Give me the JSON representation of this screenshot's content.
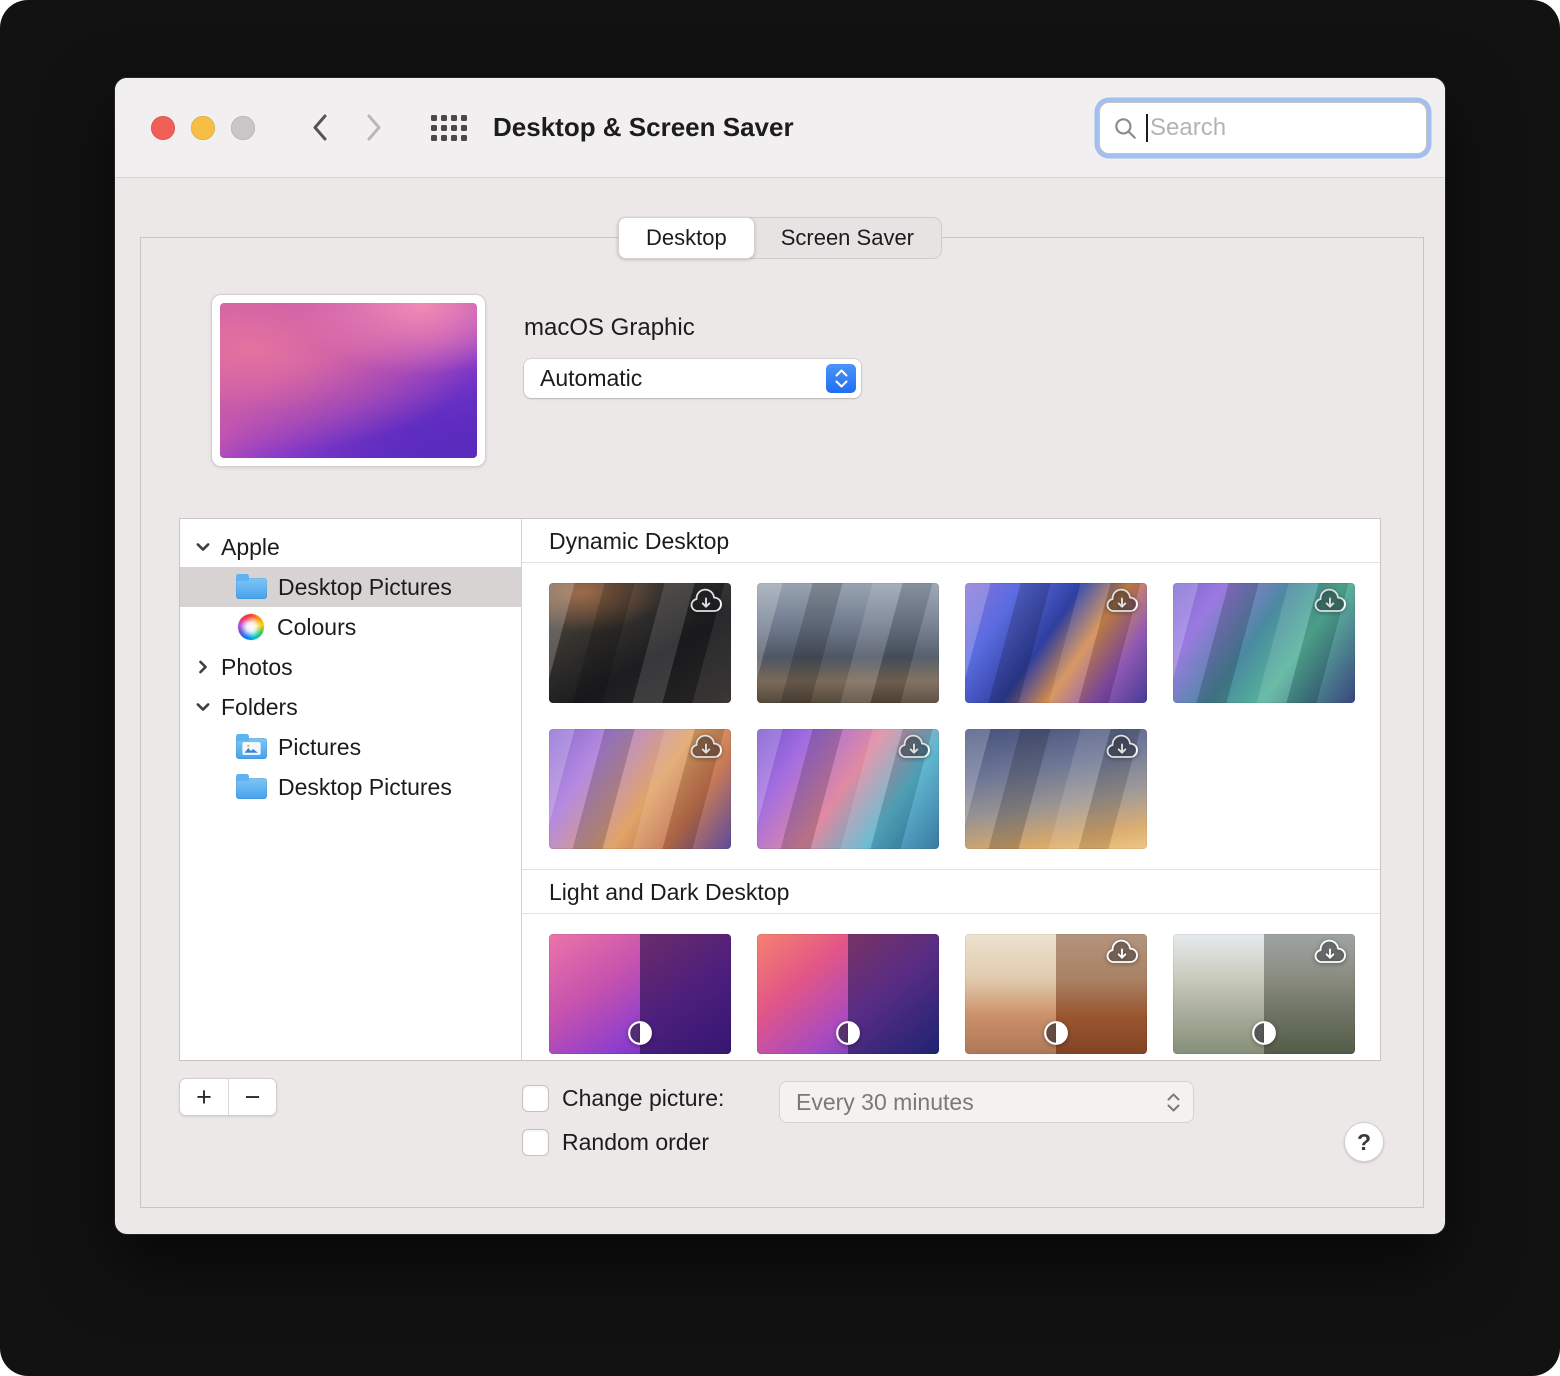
{
  "window": {
    "title": "Desktop & Screen Saver",
    "search_placeholder": "Search"
  },
  "tabs": {
    "desktop": "Desktop",
    "screen_saver": "Screen Saver"
  },
  "current": {
    "name": "macOS Graphic",
    "mode": "Automatic",
    "preview_bg": "radial-gradient(90% 80% at 78% 2%, #f08ab4 0%, rgba(240,138,180,0) 55%), radial-gradient(120% 90% at 12% 30%, #e4739f 0%, rgba(196,90,170,0.6) 45%, rgba(160,70,190,0) 75%), radial-gradient(140% 120% at 85% 95%, #5b2bbf 0%, rgba(91,43,191,0) 60%), linear-gradient(150deg, #e8709f 0%, #c957ae 38%, #9a41c9 62%, #6d32c9 82%, #5b2aa8 100%)"
  },
  "sidebar": {
    "groups": [
      {
        "label": "Apple",
        "expanded": true,
        "items": [
          {
            "label": "Desktop Pictures",
            "icon": "folder-icon",
            "selected": true
          },
          {
            "label": "Colours",
            "icon": "color-wheel-icon",
            "selected": false
          }
        ]
      },
      {
        "label": "Photos",
        "expanded": false,
        "items": []
      },
      {
        "label": "Folders",
        "expanded": true,
        "items": [
          {
            "label": "Pictures",
            "icon": "pictures-folder-icon",
            "selected": false
          },
          {
            "label": "Desktop Pictures",
            "icon": "folder-icon",
            "selected": false
          }
        ]
      }
    ]
  },
  "sections": [
    {
      "title": "Dynamic Desktop",
      "thumbnails": [
        {
          "desc": "dark-rocky-coast",
          "striped": true,
          "cloud": true,
          "contrast": false,
          "bg": "radial-gradient(80% 60% at 18% 8%, rgba(225,140,80,0.55) 0%, rgba(225,140,80,0) 55%), linear-gradient(150deg,#57504b 0%,#37332f 30%,#1c1d20 60%,#2e2a28 100%)"
        },
        {
          "desc": "island-dusk",
          "striped": true,
          "cloud": false,
          "contrast": false,
          "bg": "linear-gradient(180deg,#9aa4b2 0%,#707c8e 35%,#4e5663 62%,#7b6a58 82%,#55493c 100%)"
        },
        {
          "desc": "graphic-coast-road",
          "striped": true,
          "cloud": true,
          "contrast": false,
          "bg": "linear-gradient(125deg,#8a72d8 0%,#5a6ce0 22%,#2f3f9f 45%,#d28a4e 62%,#8a4fae 80%,#3b2f8f 100%)"
        },
        {
          "desc": "graphic-lake",
          "striped": true,
          "cloud": true,
          "contrast": false,
          "bg": "linear-gradient(125deg,#7a66d2 0%,#9a7ae0 20%,#4a8aa0 45%,#55b39a 65%,#2c3a74 100%)"
        },
        {
          "desc": "graphic-desert",
          "striped": true,
          "cloud": true,
          "contrast": false,
          "bg": "linear-gradient(125deg,#8a68d0 0%,#b58ae0 25%,#e0a468 55%,#c2714c 75%,#533f96 100%)"
        },
        {
          "desc": "graphic-beach",
          "striped": true,
          "cloud": true,
          "contrast": false,
          "bg": "linear-gradient(125deg,#7450cc 0%,#a46ee0 22%,#e08aa2 48%,#57b4cc 72%,#2e6f9e 100%)"
        },
        {
          "desc": "solar-gradient",
          "striped": true,
          "cloud": true,
          "contrast": false,
          "bg": "linear-gradient(170deg,#46527e 0%,#6e7795 35%,#9a9492 60%,#d9a96a 85%,#eec27a 100%)"
        }
      ]
    },
    {
      "title": "Light and Dark Desktop",
      "thumbnails": [
        {
          "desc": "purple-gradient-waves",
          "striped": false,
          "cloud": false,
          "contrast": true,
          "bg": "linear-gradient(90deg, rgba(0,0,0,0) 0%, rgba(0,0,0,0) 50%, rgba(20,5,60,0.55) 50%, rgba(20,5,60,0.55) 100%), linear-gradient(145deg,#ec74a8 0%,#c653ae 35%,#8f3ecc 65%,#5c2bb0 100%)"
        },
        {
          "desc": "red-blue-waves",
          "striped": false,
          "cloud": false,
          "contrast": true,
          "bg": "linear-gradient(90deg, rgba(0,0,0,0) 0%, rgba(0,0,0,0) 50%, rgba(10,15,70,0.5) 50%, rgba(10,15,70,0.5) 100%), linear-gradient(140deg,#f4836e 0%,#e25687 30%,#a84ac2 60%,#32379d 100%)"
        },
        {
          "desc": "white-desert-rocks",
          "striped": false,
          "cloud": true,
          "contrast": true,
          "bg": "linear-gradient(90deg, rgba(255,255,255,0.18) 0%, rgba(255,255,255,0.18) 50%, rgba(90,30,10,0.38) 50%, rgba(90,30,10,0.38) 100%), linear-gradient(180deg,#e9dcc6 0%,#dabf9a 38%,#c07848 68%,#9c5a33 100%)"
        },
        {
          "desc": "striated-hills",
          "striped": false,
          "cloud": true,
          "contrast": true,
          "bg": "linear-gradient(90deg, rgba(255,255,255,0.15) 0%, rgba(255,255,255,0.15) 50%, rgba(20,25,20,0.32) 50%, rgba(20,25,20,0.32) 100%), linear-gradient(180deg,#dfe6e9 0%,#c3c4b4 35%,#9aa08c 65%,#707b60 100%)"
        }
      ]
    }
  ],
  "footer": {
    "add_label": "+",
    "remove_label": "−",
    "change_picture_label": "Change picture:",
    "interval_value": "Every 30 minutes",
    "random_order_label": "Random order",
    "help_label": "?"
  },
  "colors": {
    "accent_blue": "#2a6df4",
    "focus_ring": "#78a5f0",
    "selection_gray": "#d6d3d2",
    "folder_blue": "#46a2ec"
  }
}
